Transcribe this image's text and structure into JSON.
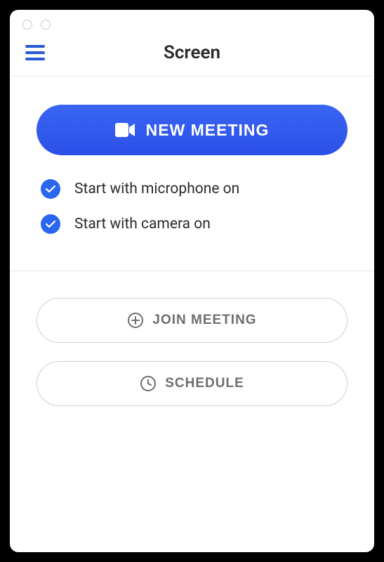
{
  "header": {
    "title": "Screen"
  },
  "colors": {
    "primary": "#2a5bd7",
    "button_gradient_top": "#3a66f3",
    "button_gradient_bottom": "#2b4fe8",
    "text": "#2a2a2a",
    "muted": "#6e6e6e"
  },
  "buttons": {
    "new_meeting": "NEW MEETING",
    "join_meeting": "JOIN MEETING",
    "schedule": "SCHEDULE"
  },
  "options": {
    "microphone": {
      "label": "Start with microphone on",
      "checked": true
    },
    "camera": {
      "label": "Start with camera on",
      "checked": true
    }
  }
}
